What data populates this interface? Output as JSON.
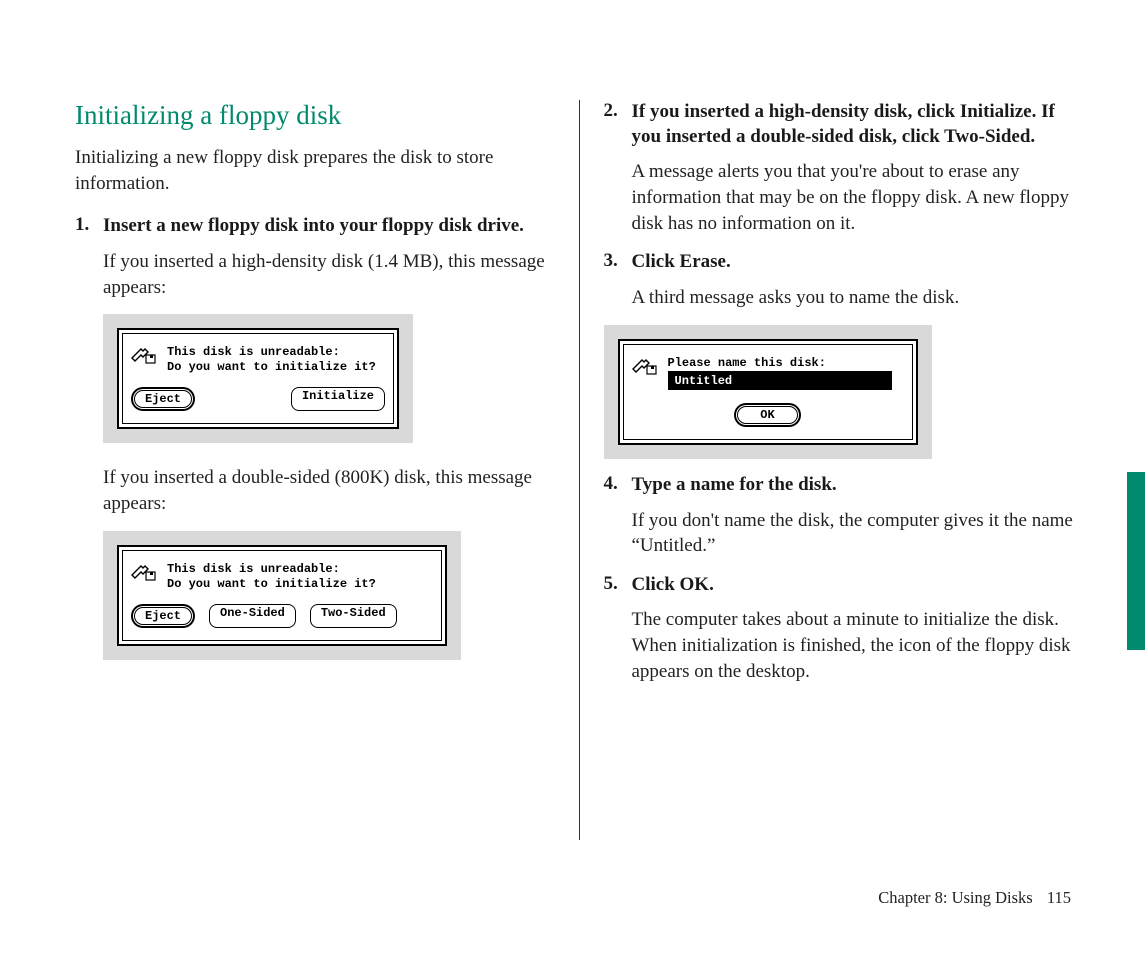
{
  "heading": "Initializing a floppy disk",
  "intro": "Initializing a new floppy disk prepares the disk to store information.",
  "left_steps": [
    {
      "head": "Insert a new floppy disk into your floppy disk drive.",
      "body1": "If you inserted a high-density disk (1.4 MB), this message appears:",
      "body2": "If you inserted a double-sided (800K) disk, this message appears:"
    }
  ],
  "right_steps": [
    {
      "head": "If you inserted a high-density disk, click Initialize. If you inserted a double-sided disk, click Two-Sided.",
      "body": "A message alerts you that you're about to erase any information that may be on the floppy disk. A new floppy disk has no information on it."
    },
    {
      "head": "Click Erase.",
      "body": "A third message asks you to name the disk."
    },
    {
      "head": "Type a name for the disk.",
      "body": "If you don't name the disk, the computer gives it the name “Untitled.”"
    },
    {
      "head": "Click OK.",
      "body": "The computer takes about a minute to initialize the disk. When initialization is finished, the icon of the floppy disk appears on the desktop."
    }
  ],
  "dialog1": {
    "line1": "This disk is unreadable:",
    "line2": "Do you want to initialize it?",
    "btn_eject": "Eject",
    "btn_initialize": "Initialize"
  },
  "dialog2": {
    "line1": "This disk is unreadable:",
    "line2": "Do you want to initialize it?",
    "btn_eject": "Eject",
    "btn_one": "One-Sided",
    "btn_two": "Two-Sided"
  },
  "dialog3": {
    "prompt": "Please name this disk:",
    "value": "Untitled",
    "btn_ok": "OK"
  },
  "footer": {
    "chapter": "Chapter 8: Using Disks",
    "page": "115"
  }
}
